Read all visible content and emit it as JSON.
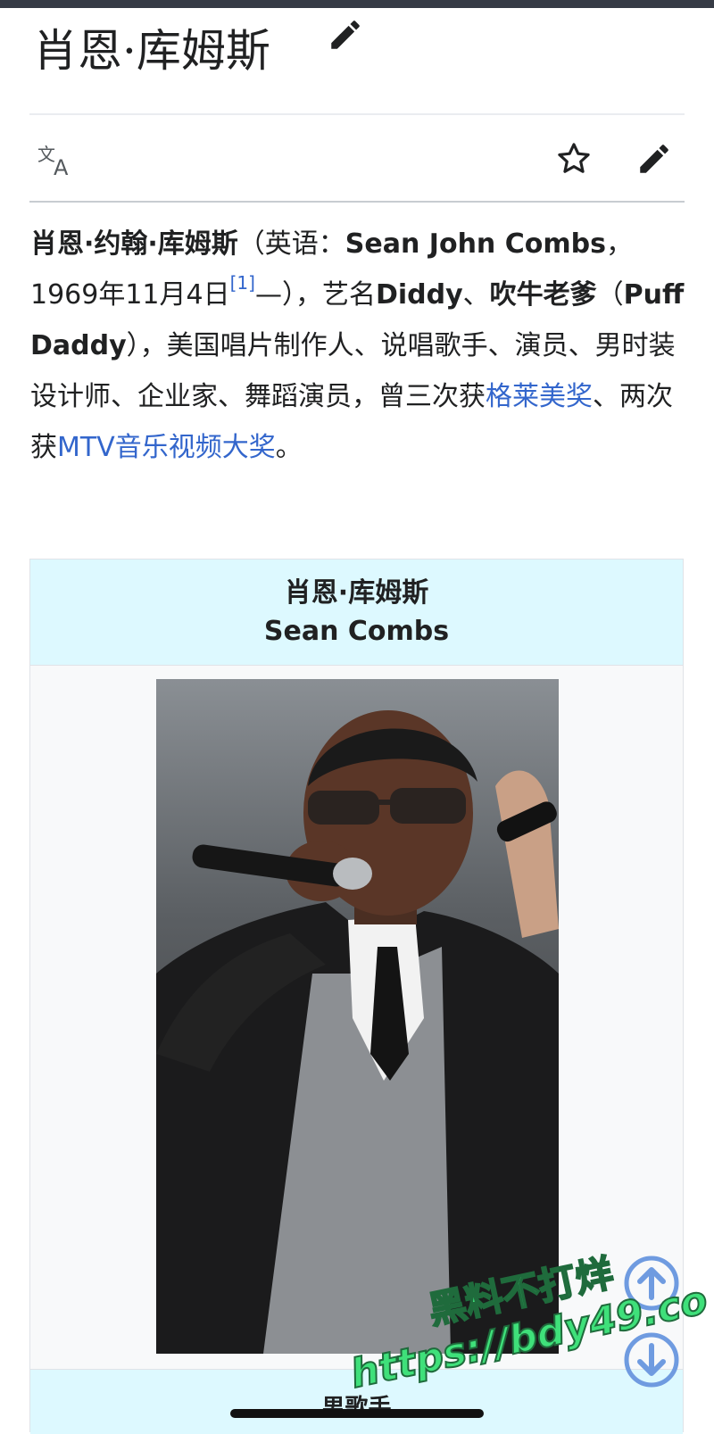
{
  "article": {
    "title": "肖恩·库姆斯"
  },
  "toolbar": {
    "language_icon": "translate-icon",
    "watch_icon": "star-icon",
    "edit_icon": "pencil-icon"
  },
  "lead": {
    "name_zh": "肖恩·约翰·库姆斯",
    "paren_open": "（英语：",
    "name_en": "Sean John Combs",
    "birth": "，1969年11月4日",
    "ref": "[1]",
    "after_ref": "—），艺名",
    "stage1": "Diddy",
    "sep1": "、",
    "stage2": "吹牛老爹",
    "paren2_open": "（",
    "stage2_en": "Puff Daddy",
    "desc1": "），美国唱片制作人、说唱歌手、演员、男时装设计师、企业家、舞蹈演员，曾三次获",
    "link_grammy": "格莱美奖",
    "desc2": "、两次获",
    "link_mtv": "MTV音乐视频大奖",
    "end": "。"
  },
  "infobox": {
    "name_zh": "肖恩·库姆斯",
    "name_en": "Sean Combs",
    "image_alt": "performer with microphone and sunglasses",
    "occupation": "男歌手"
  },
  "watermark": {
    "line1": "黑料不打烊",
    "line2": "https://bdy49.co"
  },
  "colors": {
    "link": "#3366cc",
    "infobox_header": "#ddf9ff",
    "scroll_button": "#6f9be0"
  }
}
